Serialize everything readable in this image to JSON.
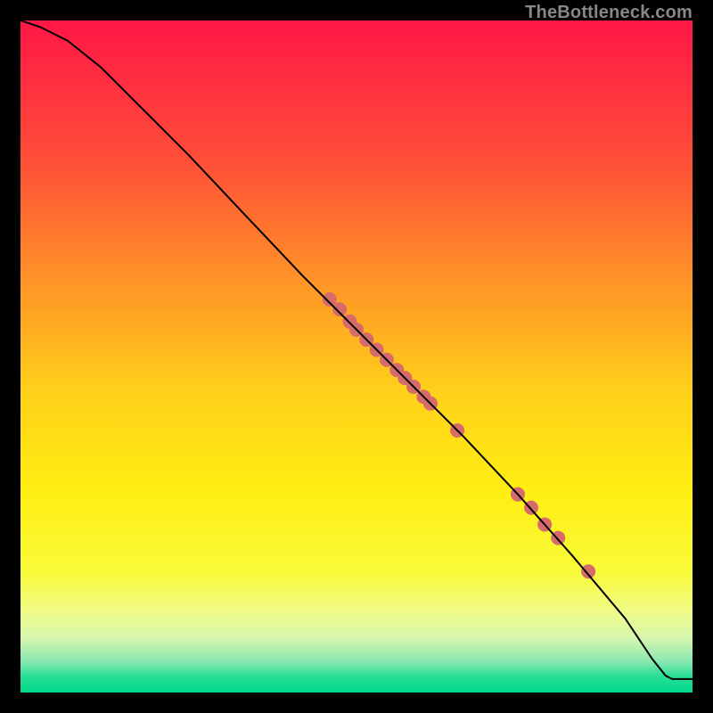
{
  "watermark": "TheBottleneck.com",
  "chart_data": {
    "type": "line",
    "title": "",
    "xlabel": "",
    "ylabel": "",
    "xlim": [
      0,
      100
    ],
    "ylim": [
      0,
      100
    ],
    "grid": false,
    "background_gradient": {
      "stops": [
        {
          "offset": 0.0,
          "color": "#ff1745"
        },
        {
          "offset": 0.2,
          "color": "#ff4c39"
        },
        {
          "offset": 0.4,
          "color": "#ff9826"
        },
        {
          "offset": 0.55,
          "color": "#ffd01a"
        },
        {
          "offset": 0.7,
          "color": "#ffee12"
        },
        {
          "offset": 0.82,
          "color": "#f9fb39"
        },
        {
          "offset": 0.88,
          "color": "#f0fb88"
        },
        {
          "offset": 0.92,
          "color": "#d4f6af"
        },
        {
          "offset": 0.955,
          "color": "#86e8b0"
        },
        {
          "offset": 0.975,
          "color": "#2adf97"
        },
        {
          "offset": 1.0,
          "color": "#00d88b"
        }
      ]
    },
    "series": [
      {
        "name": "curve",
        "color": "#000000",
        "width": 2,
        "points": [
          {
            "x": 0.0,
            "y": 100.0
          },
          {
            "x": 3.0,
            "y": 99.0
          },
          {
            "x": 7.0,
            "y": 97.0
          },
          {
            "x": 12.0,
            "y": 93.0
          },
          {
            "x": 18.0,
            "y": 87.0
          },
          {
            "x": 25.0,
            "y": 80.0
          },
          {
            "x": 33.0,
            "y": 71.5
          },
          {
            "x": 42.0,
            "y": 62.0
          },
          {
            "x": 50.0,
            "y": 54.0
          },
          {
            "x": 58.0,
            "y": 46.0
          },
          {
            "x": 66.0,
            "y": 38.0
          },
          {
            "x": 74.0,
            "y": 29.5
          },
          {
            "x": 82.0,
            "y": 20.5
          },
          {
            "x": 90.0,
            "y": 11.0
          },
          {
            "x": 94.0,
            "y": 5.0
          },
          {
            "x": 96.0,
            "y": 2.5
          },
          {
            "x": 97.0,
            "y": 2.0
          },
          {
            "x": 100.0,
            "y": 2.0
          }
        ]
      }
    ],
    "markers": {
      "name": "highlighted-points",
      "color": "#d76b6b",
      "radius": 8,
      "points": [
        {
          "x": 46.0,
          "y": 58.5
        },
        {
          "x": 47.5,
          "y": 57.0
        },
        {
          "x": 49.0,
          "y": 55.2
        },
        {
          "x": 50.0,
          "y": 54.0
        },
        {
          "x": 51.5,
          "y": 52.5
        },
        {
          "x": 53.0,
          "y": 51.0
        },
        {
          "x": 54.5,
          "y": 49.5
        },
        {
          "x": 56.0,
          "y": 48.0
        },
        {
          "x": 57.2,
          "y": 46.8
        },
        {
          "x": 58.5,
          "y": 45.5
        },
        {
          "x": 60.0,
          "y": 44.0
        },
        {
          "x": 61.0,
          "y": 43.0
        },
        {
          "x": 65.0,
          "y": 39.0
        },
        {
          "x": 74.0,
          "y": 29.5
        },
        {
          "x": 76.0,
          "y": 27.5
        },
        {
          "x": 78.0,
          "y": 25.0
        },
        {
          "x": 80.0,
          "y": 23.0
        },
        {
          "x": 84.5,
          "y": 18.0
        }
      ]
    }
  }
}
